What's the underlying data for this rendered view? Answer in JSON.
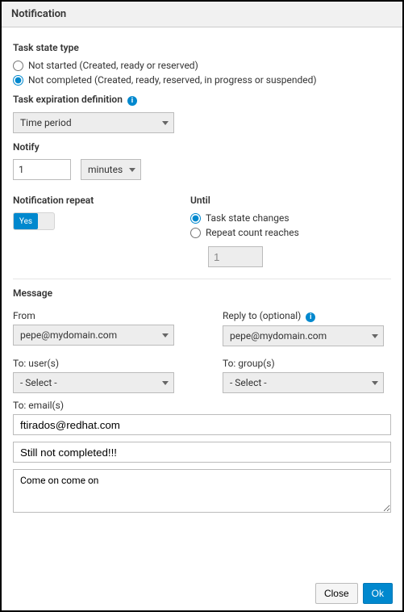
{
  "titlebar": "Notification",
  "task_state_type": {
    "label": "Task state type",
    "options": {
      "not_started": "Not started (Created, ready or reserved)",
      "not_completed": "Not completed (Created, ready, reserved, in progress or suspended)"
    },
    "selected": "not_completed"
  },
  "expiration": {
    "label": "Task expiration definition",
    "selected": "Time period"
  },
  "notify": {
    "label": "Notify",
    "value": "1",
    "unit": "minutes"
  },
  "repeat": {
    "label": "Notification repeat",
    "value_label": "Yes"
  },
  "until": {
    "label": "Until",
    "options": {
      "state_changes": "Task state changes",
      "count_reaches": "Repeat count reaches"
    },
    "selected": "state_changes",
    "count_value": "1"
  },
  "message": {
    "label": "Message",
    "from": {
      "label": "From",
      "value": "pepe@mydomain.com"
    },
    "reply_to": {
      "label": "Reply to (optional)",
      "value": "pepe@mydomain.com"
    },
    "to_users": {
      "label": "To: user(s)",
      "value": "- Select -"
    },
    "to_groups": {
      "label": "To: group(s)",
      "value": "- Select -"
    },
    "to_emails": {
      "label": "To: email(s)",
      "value": "ftirados@redhat.com"
    },
    "subject": "Still not completed!!!",
    "body": "Come on come on"
  },
  "footer": {
    "close": "Close",
    "ok": "Ok"
  }
}
